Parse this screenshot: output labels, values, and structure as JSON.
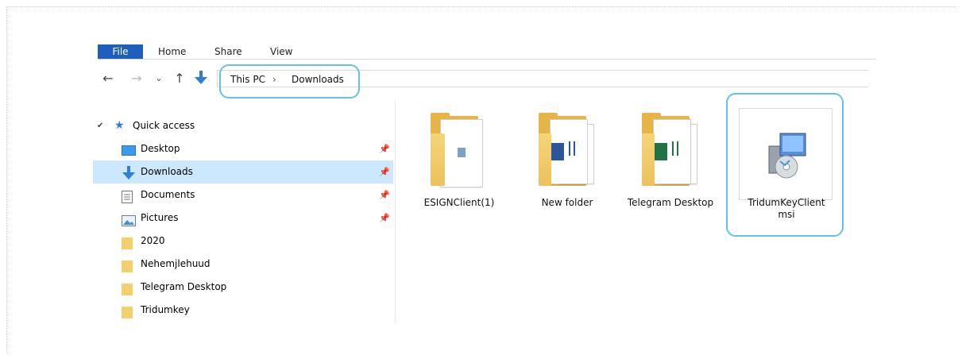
{
  "ribbon": {
    "tabs": [
      "File",
      "Home",
      "Share",
      "View"
    ]
  },
  "nav": {
    "back": "←",
    "forward": "→",
    "recent": "⌄",
    "up": "↑",
    "crumbs": [
      "This PC",
      "›",
      "Downloads"
    ]
  },
  "pane": {
    "quick_access": "Quick access",
    "items": [
      {
        "label": "Desktop",
        "pinned": true
      },
      {
        "label": "Downloads",
        "pinned": true,
        "selected": true
      },
      {
        "label": "Documents",
        "pinned": true
      },
      {
        "label": "Pictures",
        "pinned": true
      },
      {
        "label": "2020",
        "pinned": false
      },
      {
        "label": "Nehemjlehuud",
        "pinned": false
      },
      {
        "label": "Telegram Desktop",
        "pinned": false
      },
      {
        "label": "Tridumkey",
        "pinned": false
      }
    ]
  },
  "files": [
    {
      "name": "ESIGNClient(1)",
      "type": "folder"
    },
    {
      "name": "New folder",
      "type": "folder"
    },
    {
      "name": "Telegram Desktop",
      "type": "folder"
    },
    {
      "name": "TridumKeyClient msi",
      "type": "msi",
      "line1": "TridumKeyClient",
      "line2": "msi"
    }
  ],
  "colors": {
    "accent": "#1e5ebd",
    "highlight": "#64c3e3",
    "selection": "#cce8ff",
    "folder": "#e6b548"
  }
}
